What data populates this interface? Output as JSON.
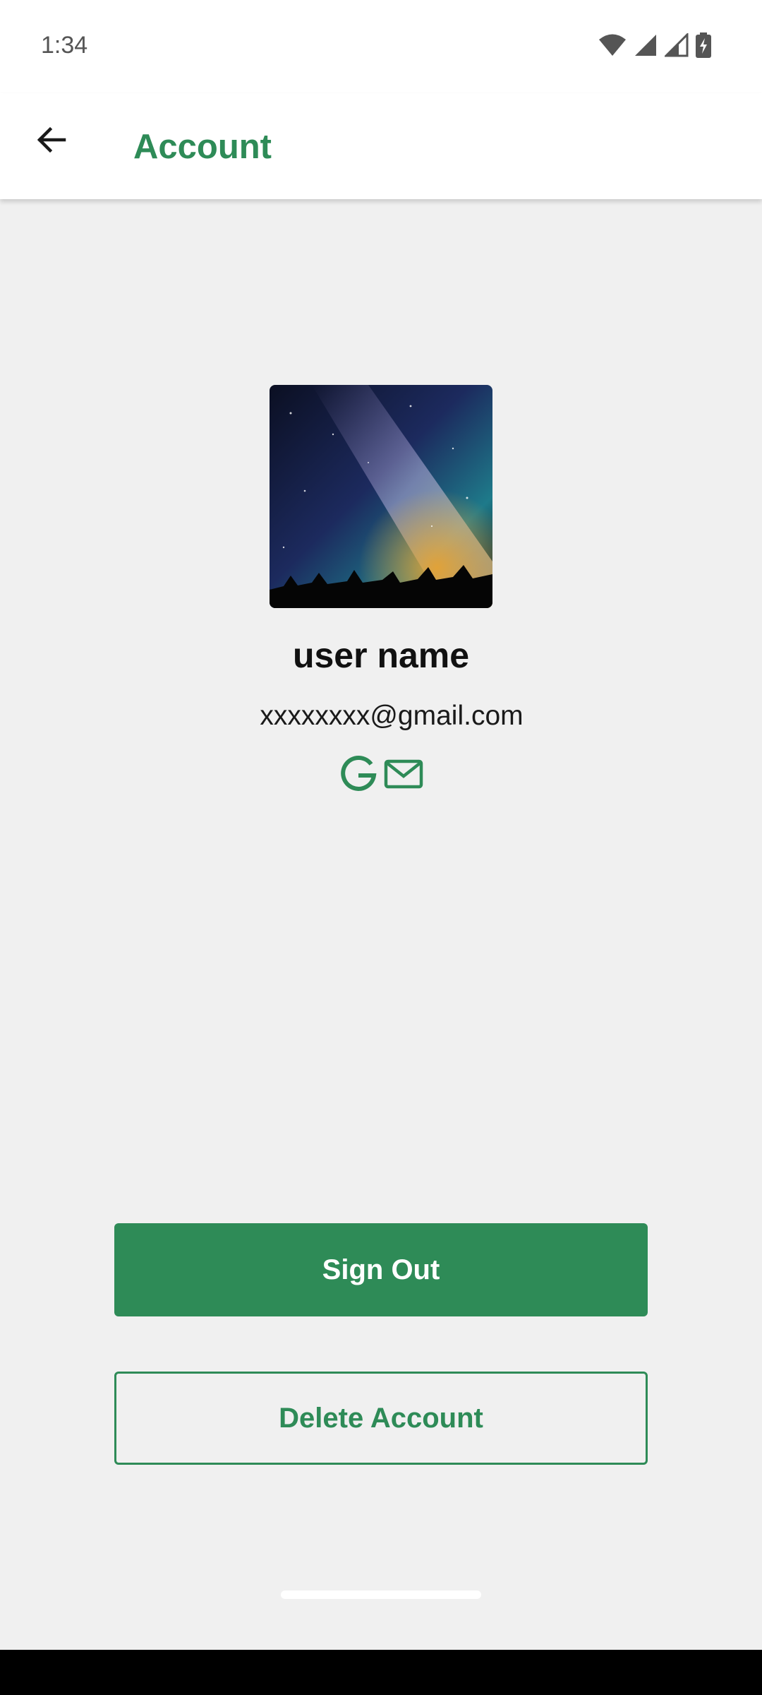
{
  "colors": {
    "accent": "#2e8b57",
    "background": "#f0f0f0",
    "app_bar": "#ffffff",
    "on_accent": "#ffffff"
  },
  "status_bar": {
    "time": "1:34",
    "icons": [
      "wifi-icon",
      "signal-icon",
      "signal-icon",
      "battery-charging-icon"
    ]
  },
  "app_bar": {
    "back_icon": "arrow-left-icon",
    "title": "Account"
  },
  "profile": {
    "avatar": "night-sky-milky-way-image",
    "name": "user name",
    "email": "xxxxxxxx@gmail.com",
    "providers": [
      "google-icon",
      "email-icon"
    ]
  },
  "actions": {
    "sign_out": "Sign Out",
    "delete_account": "Delete Account"
  },
  "nav": {
    "home_handle": "home-indicator"
  }
}
